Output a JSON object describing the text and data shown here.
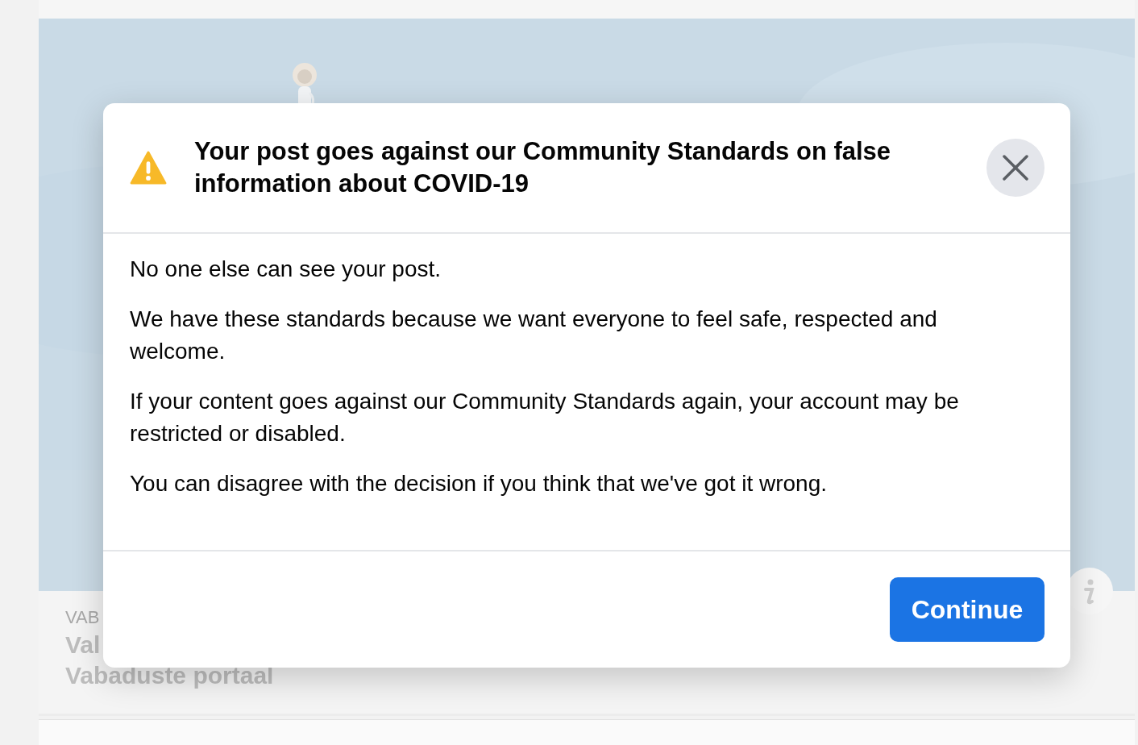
{
  "background_card": {
    "kind": "picture",
    "source": "VAB",
    "title": "Val",
    "subtitle": "Vabaduste portaal"
  },
  "dialog": {
    "title": "Your post goes against our Community Standards on false information about COVID-19",
    "paragraphs": [
      "No one else can see your post.",
      "We have these standards because we want everyone to feel safe, respected and welcome.",
      "If your content goes against our Community Standards again, your account may be restricted or disabled.",
      "You can disagree with the decision if you think that we've got it wrong."
    ],
    "button": "Continue"
  }
}
